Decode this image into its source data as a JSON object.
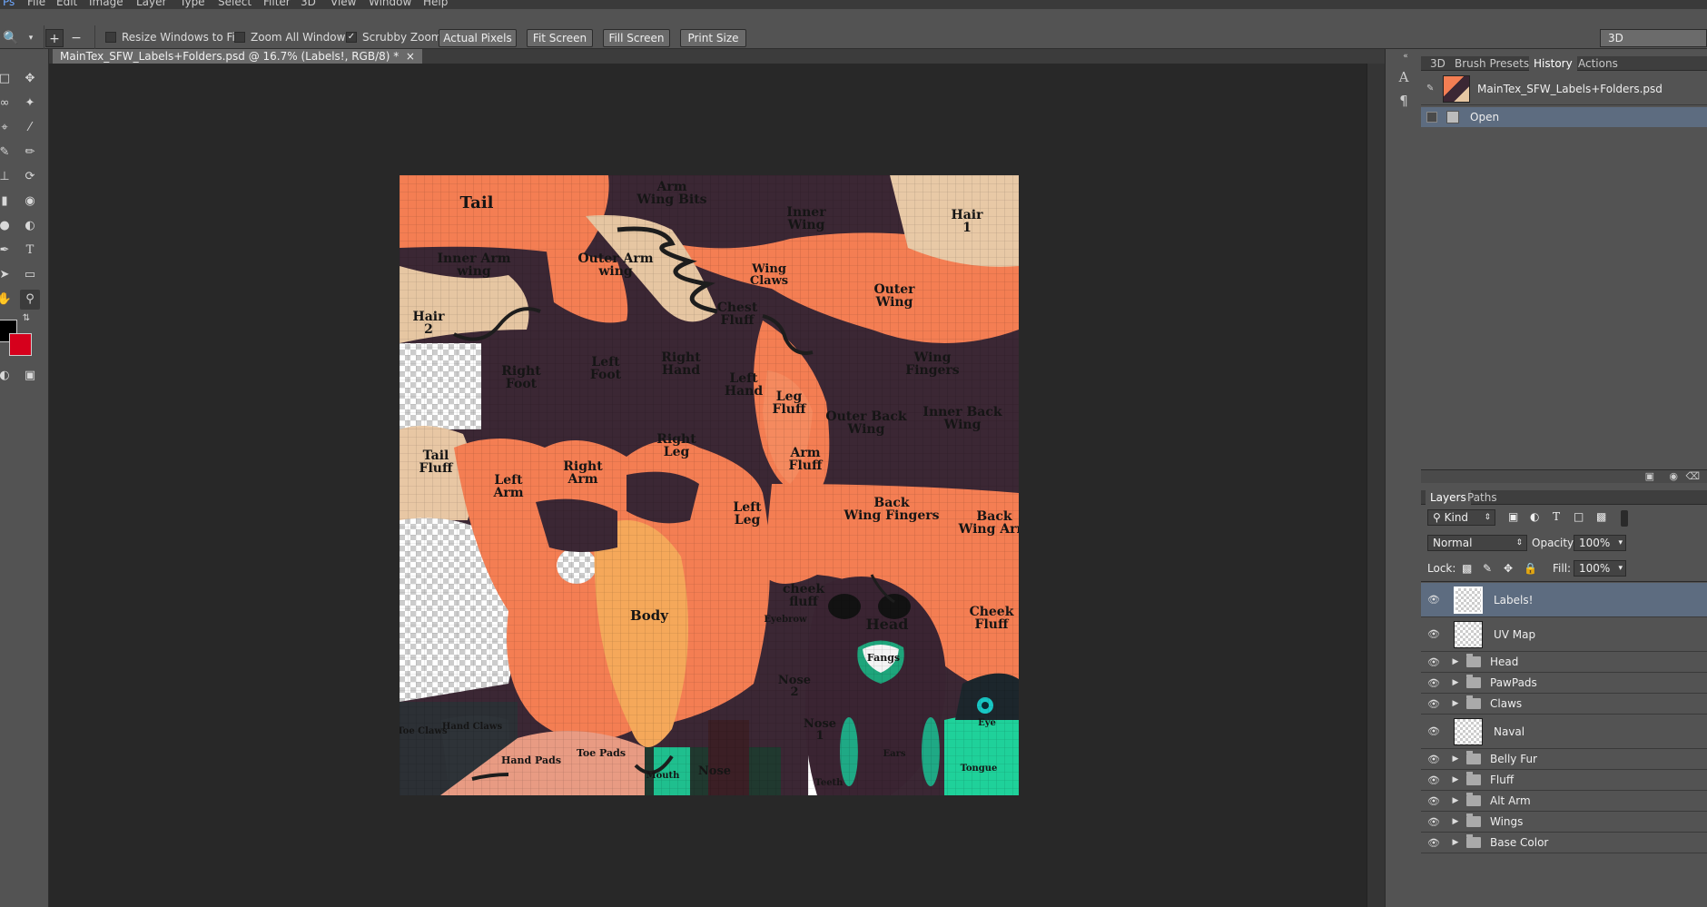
{
  "menu": [
    "File",
    "Edit",
    "Image",
    "Layer",
    "Type",
    "Select",
    "Filter",
    "3D",
    "View",
    "Window",
    "Help"
  ],
  "options": {
    "zoom_in_icon": "zoom-in-icon",
    "zoom_out_icon": "zoom-out-icon",
    "resize_windows": {
      "label": "Resize Windows to Fit",
      "checked": false
    },
    "zoom_all": {
      "label": "Zoom All Windows",
      "checked": false
    },
    "scrubby": {
      "label": "Scrubby Zoom",
      "checked": true
    },
    "buttons": [
      "Actual Pixels",
      "Fit Screen",
      "Fill Screen",
      "Print Size"
    ],
    "workspace": "3D"
  },
  "document": {
    "tab_title": "MainTex_SFW_Labels+Folders.psd @ 16.7% (Labels!, RGB/8) *",
    "close_glyph": "×"
  },
  "canvas_labels": [
    "Tail",
    "Arm Wing Bits",
    "Inner Wing",
    "Hair 1",
    "Inner Arm wing",
    "Outer Arm wing",
    "Wing Claws",
    "Outer Wing",
    "Hair 2",
    "Chest Fluff",
    "Wing Fingers",
    "Right Foot",
    "Left Foot",
    "Right Hand",
    "Left Hand",
    "Leg Fluff",
    "Outer Back Wing",
    "Inner Back Wing",
    "Tail Fluff",
    "Left Arm",
    "Right Arm",
    "Right Leg",
    "Arm Fluff",
    "Left Leg",
    "Back Wing Fingers",
    "Back Wing Arm",
    "cheek fluff",
    "Eyebrow",
    "Body",
    "Head",
    "Cheek Fluff",
    "Fangs",
    "Nose 2",
    "Nose 1",
    "Eye",
    "Toe Claws",
    "Hand Claws",
    "Hand Pads",
    "Toe Pads",
    "Mouth",
    "Nose",
    "Teeth",
    "Ears",
    "Tongue"
  ],
  "top_panel": {
    "tabs": [
      "3D",
      "Brush Presets",
      "History",
      "Actions"
    ],
    "active_tab": "History",
    "snapshot": "MainTex_SFW_Labels+Folders.psd",
    "history_items": [
      "Open"
    ]
  },
  "layers_panel": {
    "tabs": [
      "Layers",
      "Paths"
    ],
    "active_tab": "Layers",
    "filter": "Kind",
    "blend_mode": "Normal",
    "opacity_label": "Opacity:",
    "opacity": "100%",
    "lock_label": "Lock:",
    "fill_label": "Fill:",
    "fill": "100%",
    "layers": [
      {
        "name": "Labels!",
        "type": "layer",
        "selected": true
      },
      {
        "name": "UV Map",
        "type": "layer",
        "selected": false
      },
      {
        "name": "Head",
        "type": "group",
        "selected": false
      },
      {
        "name": "PawPads",
        "type": "group",
        "selected": false
      },
      {
        "name": "Claws",
        "type": "group",
        "selected": false
      },
      {
        "name": "Naval",
        "type": "layer",
        "selected": false
      },
      {
        "name": "Belly Fur",
        "type": "group",
        "selected": false
      },
      {
        "name": "Fluff",
        "type": "group",
        "selected": false
      },
      {
        "name": "Alt Arm",
        "type": "group",
        "selected": false
      },
      {
        "name": "Wings",
        "type": "group",
        "selected": false
      },
      {
        "name": "Base Color",
        "type": "group",
        "selected": false
      }
    ]
  },
  "colors": {
    "foreground": "#000000",
    "background": "#d6001c",
    "accent": "#5d6c80"
  }
}
